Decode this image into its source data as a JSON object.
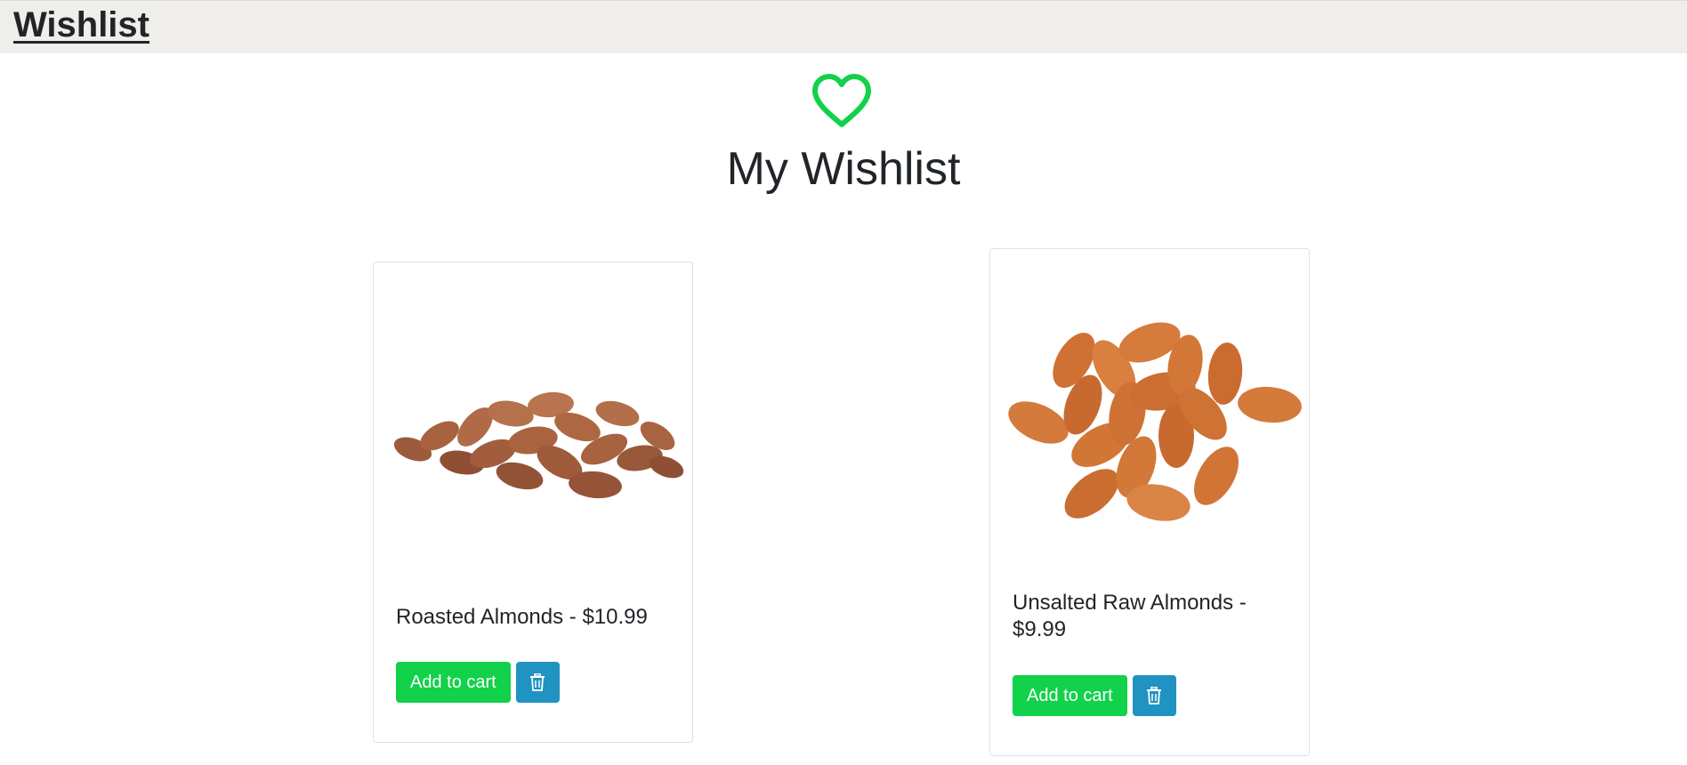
{
  "nav": {
    "brand": "Wishlist"
  },
  "header": {
    "icon": "heart-outline-icon",
    "title": "My Wishlist"
  },
  "colors": {
    "accent_green": "#12d14a",
    "delete_blue": "#2093c2",
    "heart_green": "#12d14a"
  },
  "products": [
    {
      "name": "Roasted Almonds - $10.99",
      "image": "roasted-almonds",
      "add_to_cart_label": "Add to cart",
      "delete_icon": "trash-icon"
    },
    {
      "name": "Unsalted Raw Almonds - $9.99",
      "image": "raw-almonds",
      "add_to_cart_label": "Add to cart",
      "delete_icon": "trash-icon"
    }
  ]
}
